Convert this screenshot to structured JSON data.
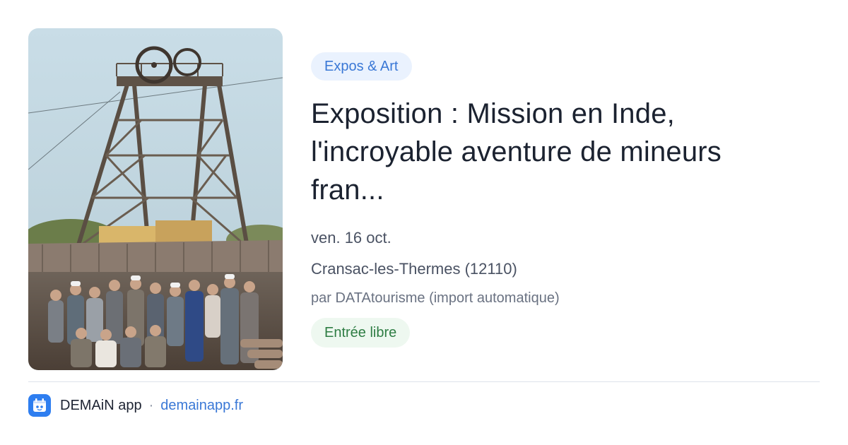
{
  "card": {
    "category": "Expos & Art",
    "title": "Exposition : Mission en Inde, l'incroyable aventure de mineurs fran...",
    "date": "ven. 16 oct.",
    "location": "Cransac-les-Thermes (12110)",
    "author": "par DATAtourisme (import automatique)",
    "price": "Entrée libre",
    "image": {
      "icon": "mine-headframe-with-miners-photo"
    }
  },
  "footer": {
    "app_name": "DEMAiN app",
    "separator": "·",
    "domain": "demainapp.fr",
    "app_icon": "demain-app-icon"
  },
  "colors": {
    "accent": "#3a78d6",
    "category_bg": "#eaf2fe",
    "free_text": "#2e7d43",
    "free_bg": "#eef8f0",
    "divider": "#dde3ea"
  }
}
